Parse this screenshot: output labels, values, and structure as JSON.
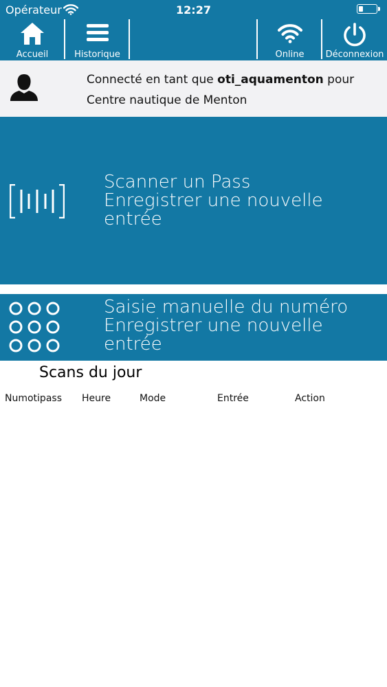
{
  "status_bar": {
    "carrier": "Opérateur",
    "time": "12:27",
    "battery_level": 0.25
  },
  "nav": {
    "home_label": "Accueil",
    "history_label": "Historique",
    "online_label": "Online",
    "logout_label": "Déconnexion",
    "icons": {
      "home": "home-icon",
      "history": "menu-icon",
      "online": "wifi-icon",
      "logout": "power-icon"
    }
  },
  "user": {
    "prefix": "Connecté en tant que",
    "username": "oti_aquamenton",
    "suffix": "pour",
    "center": "Centre nautique de Menton"
  },
  "scan_panel": {
    "title": "Scanner un Pass",
    "subtitle": "Enregistrer une nouvelle entrée"
  },
  "manual_panel": {
    "title": "Saisie manuelle du numéro",
    "subtitle": "Enregistrer une nouvelle entrée"
  },
  "scans": {
    "title": "Scans du jour",
    "columns": [
      "Numotipass",
      "Heure",
      "Mode",
      "Entrée",
      "Action"
    ]
  },
  "colors": {
    "primary": "#1378a4",
    "user_bar": "#f2f2f4"
  }
}
